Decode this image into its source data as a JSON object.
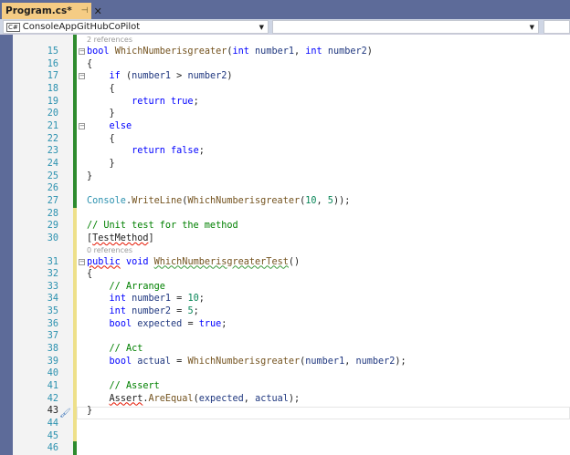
{
  "tab": {
    "title": "Program.cs*",
    "pin_icon": "pin-icon",
    "close_icon": "close-icon"
  },
  "navbar": {
    "project": "ConsoleAppGitHubCoPilot",
    "member": "",
    "extra": ""
  },
  "editor": {
    "current_line": "43",
    "lines": [
      {
        "ref": "2 references"
      },
      {
        "n": "15",
        "fold": "−",
        "tokens": [
          [
            "bool",
            "kw"
          ],
          [
            " ",
            "pl"
          ],
          [
            "WhichNumberisgreater",
            "mt"
          ],
          [
            "(",
            "pl"
          ],
          [
            "int",
            "kw"
          ],
          [
            " ",
            "pl"
          ],
          [
            "number1",
            "vr"
          ],
          [
            ", ",
            "pl"
          ],
          [
            "int",
            "kw"
          ],
          [
            " ",
            "pl"
          ],
          [
            "number2",
            "vr"
          ],
          [
            ")",
            "pl"
          ]
        ]
      },
      {
        "n": "16",
        "tokens": [
          [
            "{",
            "pl"
          ]
        ]
      },
      {
        "n": "17",
        "fold": "−",
        "tokens": [
          [
            "    ",
            "pl"
          ],
          [
            "if",
            "kw"
          ],
          [
            " (",
            "pl"
          ],
          [
            "number1",
            "vr"
          ],
          [
            " > ",
            "pl"
          ],
          [
            "number2",
            "vr"
          ],
          [
            ")",
            "pl"
          ]
        ]
      },
      {
        "n": "18",
        "tokens": [
          [
            "    {",
            "pl"
          ]
        ]
      },
      {
        "n": "19",
        "tokens": [
          [
            "        ",
            "pl"
          ],
          [
            "return",
            "kw"
          ],
          [
            " ",
            "pl"
          ],
          [
            "true",
            "kw"
          ],
          [
            ";",
            "pl"
          ]
        ]
      },
      {
        "n": "20",
        "tokens": [
          [
            "    }",
            "pl"
          ]
        ]
      },
      {
        "n": "21",
        "fold": "−",
        "tokens": [
          [
            "    ",
            "pl"
          ],
          [
            "else",
            "kw"
          ]
        ]
      },
      {
        "n": "22",
        "tokens": [
          [
            "    {",
            "pl"
          ]
        ]
      },
      {
        "n": "23",
        "tokens": [
          [
            "        ",
            "pl"
          ],
          [
            "return",
            "kw"
          ],
          [
            " ",
            "pl"
          ],
          [
            "false",
            "kw"
          ],
          [
            ";",
            "pl"
          ]
        ]
      },
      {
        "n": "24",
        "tokens": [
          [
            "    }",
            "pl"
          ]
        ]
      },
      {
        "n": "25",
        "tokens": [
          [
            "}",
            "pl"
          ]
        ]
      },
      {
        "n": "26",
        "tokens": []
      },
      {
        "n": "27",
        "tokens": [
          [
            "Console",
            "ty"
          ],
          [
            ".",
            "pl"
          ],
          [
            "WriteLine",
            "mt"
          ],
          [
            "(",
            "pl"
          ],
          [
            "WhichNumberisgreater",
            "mt"
          ],
          [
            "(",
            "pl"
          ],
          [
            "10",
            "nm"
          ],
          [
            ", ",
            "pl"
          ],
          [
            "5",
            "nm"
          ],
          [
            "));",
            "pl"
          ]
        ]
      },
      {
        "n": "28",
        "tokens": []
      },
      {
        "n": "29",
        "tokens": [
          [
            "// Unit test for the method",
            "cm"
          ]
        ]
      },
      {
        "n": "30",
        "tokens": [
          [
            "[",
            "pl"
          ],
          [
            "TestMethod",
            "pl sq"
          ],
          [
            "]",
            "pl"
          ]
        ]
      },
      {
        "ref": "0 references"
      },
      {
        "n": "31",
        "fold": "−",
        "tokens": [
          [
            "public",
            "kw sq"
          ],
          [
            " ",
            "pl"
          ],
          [
            "void",
            "kw"
          ],
          [
            " ",
            "pl"
          ],
          [
            "WhichNumberisgreaterTest",
            "mt sqg"
          ],
          [
            "()",
            "pl"
          ]
        ]
      },
      {
        "n": "32",
        "tokens": [
          [
            "{",
            "pl"
          ]
        ]
      },
      {
        "n": "33",
        "tokens": [
          [
            "    ",
            "pl"
          ],
          [
            "// Arrange",
            "cm"
          ]
        ]
      },
      {
        "n": "34",
        "tokens": [
          [
            "    ",
            "pl"
          ],
          [
            "int",
            "kw"
          ],
          [
            " ",
            "pl"
          ],
          [
            "number1",
            "vr"
          ],
          [
            " = ",
            "pl"
          ],
          [
            "10",
            "nm"
          ],
          [
            ";",
            "pl"
          ]
        ]
      },
      {
        "n": "35",
        "tokens": [
          [
            "    ",
            "pl"
          ],
          [
            "int",
            "kw"
          ],
          [
            " ",
            "pl"
          ],
          [
            "number2",
            "vr"
          ],
          [
            " = ",
            "pl"
          ],
          [
            "5",
            "nm"
          ],
          [
            ";",
            "pl"
          ]
        ]
      },
      {
        "n": "36",
        "tokens": [
          [
            "    ",
            "pl"
          ],
          [
            "bool",
            "kw"
          ],
          [
            " ",
            "pl"
          ],
          [
            "expected",
            "vr"
          ],
          [
            " = ",
            "pl"
          ],
          [
            "true",
            "kw"
          ],
          [
            ";",
            "pl"
          ]
        ]
      },
      {
        "n": "37",
        "tokens": []
      },
      {
        "n": "38",
        "tokens": [
          [
            "    ",
            "pl"
          ],
          [
            "// Act",
            "cm"
          ]
        ]
      },
      {
        "n": "39",
        "tokens": [
          [
            "    ",
            "pl"
          ],
          [
            "bool",
            "kw"
          ],
          [
            " ",
            "pl"
          ],
          [
            "actual",
            "vr"
          ],
          [
            " = ",
            "pl"
          ],
          [
            "WhichNumberisgreater",
            "mt"
          ],
          [
            "(",
            "pl"
          ],
          [
            "number1",
            "vr"
          ],
          [
            ", ",
            "pl"
          ],
          [
            "number2",
            "vr"
          ],
          [
            ");",
            "pl"
          ]
        ]
      },
      {
        "n": "40",
        "tokens": []
      },
      {
        "n": "41",
        "tokens": [
          [
            "    ",
            "pl"
          ],
          [
            "// Assert",
            "cm"
          ]
        ]
      },
      {
        "n": "42",
        "tokens": [
          [
            "    ",
            "pl"
          ],
          [
            "Assert",
            "pl sq"
          ],
          [
            ".",
            "pl"
          ],
          [
            "AreEqual",
            "mt"
          ],
          [
            "(",
            "pl"
          ],
          [
            "expected",
            "vr"
          ],
          [
            ", ",
            "pl"
          ],
          [
            "actual",
            "vr"
          ],
          [
            ");",
            "pl"
          ]
        ]
      },
      {
        "n": "43",
        "tokens": [
          [
            "}",
            "pl"
          ]
        ]
      },
      {
        "n": "44",
        "tokens": []
      },
      {
        "n": "45",
        "tokens": []
      },
      {
        "n": "46",
        "tokens": []
      }
    ]
  }
}
